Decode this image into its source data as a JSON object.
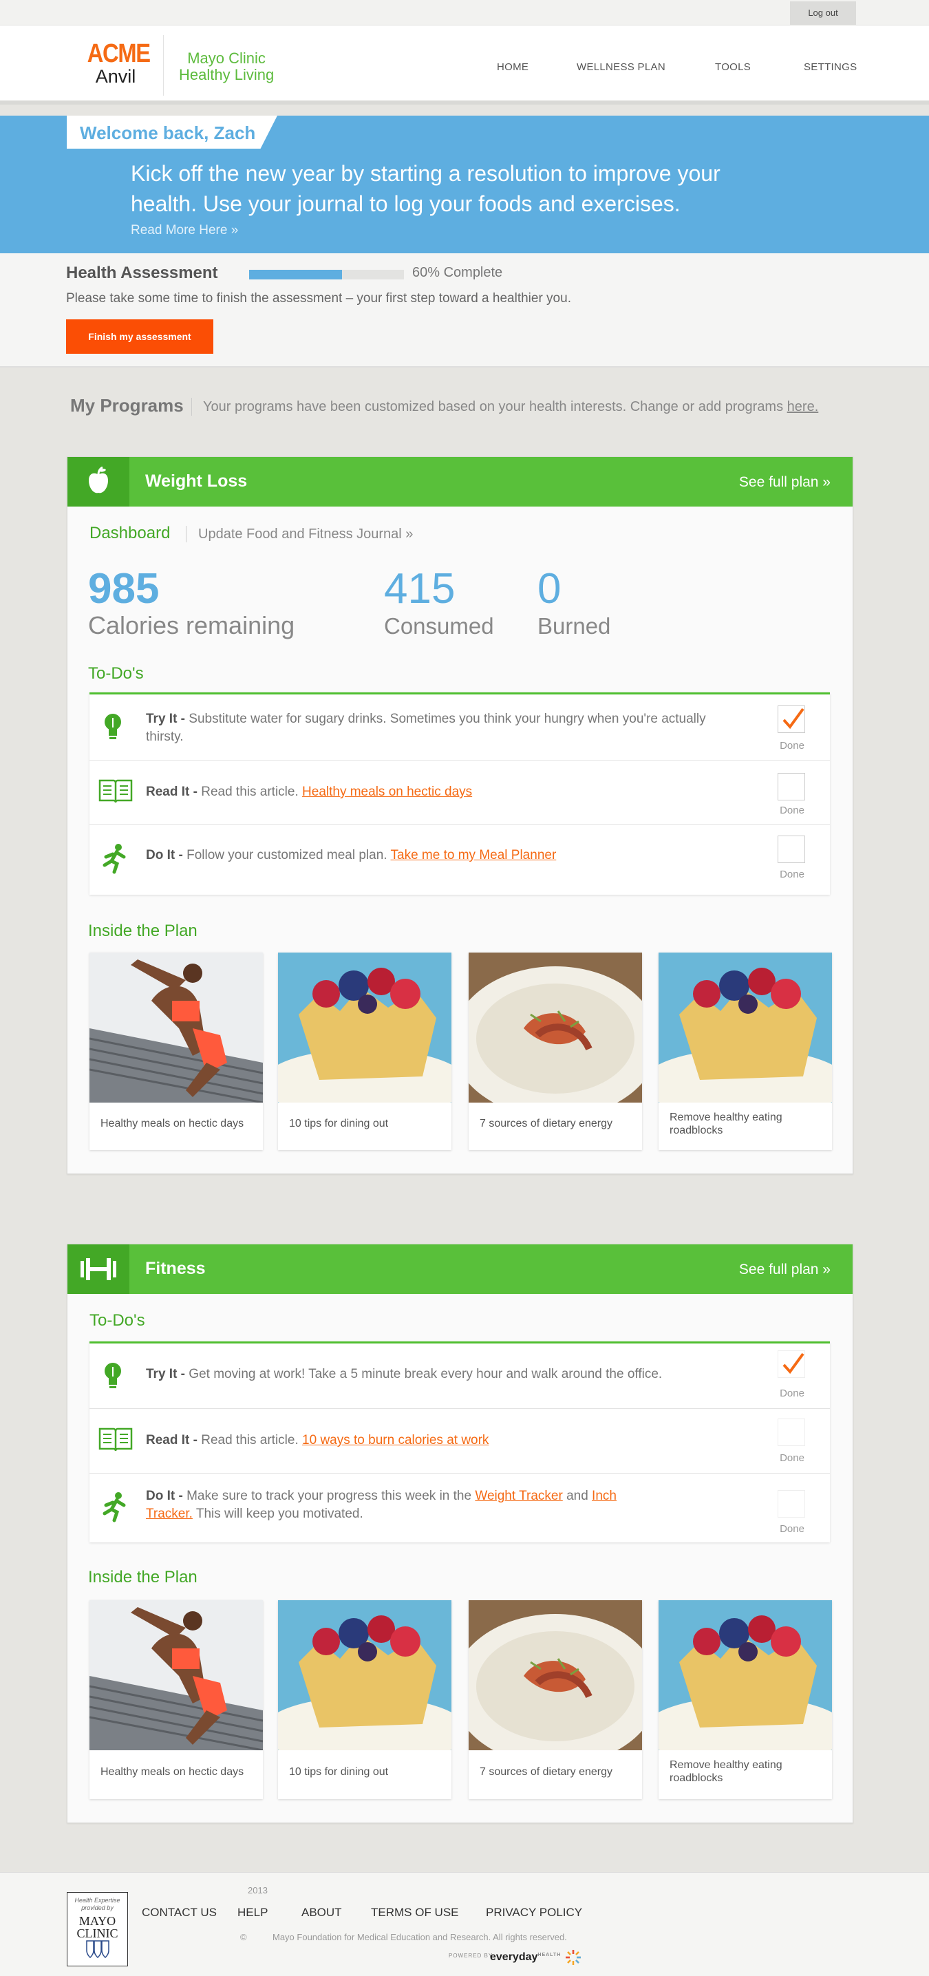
{
  "topbar": {
    "logout_label": "Log out"
  },
  "header": {
    "logo_line1": "ACME",
    "logo_line2": "Anvil",
    "partner_line1": "Mayo Clinic",
    "partner_line2": "Healthy Living",
    "nav": [
      "HOME",
      "WELLNESS PLAN",
      "TOOLS",
      "SETTINGS"
    ]
  },
  "banner": {
    "welcome": "Welcome back, Zach",
    "message": "Kick off the new year by starting a resolution to improve your health. Use your journal to log your foods and exercises.",
    "read_more": "Read More Here »"
  },
  "assessment": {
    "title": "Health Assessment",
    "progress_percent": 60,
    "progress_text": "60% Complete",
    "description": "Please take some time to finish the assessment – your first step toward a healthier you.",
    "button": "Finish my assessment"
  },
  "programs": {
    "title": "My Programs",
    "description": "Your programs have been customized based on your health interests. Change or add programs",
    "link": "here."
  },
  "weight_loss": {
    "title": "Weight Loss",
    "full_plan": "See full plan »",
    "dashboard_tab": "Dashboard",
    "update_tab": "Update Food and Fitness Journal »",
    "stats": {
      "remaining_value": "985",
      "remaining_label": "Calories remaining",
      "consumed_value": "415",
      "consumed_label": "Consumed",
      "burned_value": "0",
      "burned_label": "Burned"
    },
    "todo_heading": "To-Do's",
    "todos": [
      {
        "type": "Try It -",
        "text": "Substitute water for sugary drinks. Sometimes you think your hungry when you're actually thirsty.",
        "done": true,
        "done_label": "Done"
      },
      {
        "type": "Read It -",
        "text": "Read this article.",
        "link": "Healthy meals on hectic days",
        "done": false,
        "done_label": "Done"
      },
      {
        "type": "Do It -",
        "text": "Follow your customized meal plan.",
        "link": "Take me to my Meal Planner",
        "done": false,
        "done_label": "Done"
      }
    ],
    "inside_heading": "Inside the Plan",
    "articles": [
      "Healthy meals on hectic days",
      "10 tips for dining out",
      "7 sources of dietary energy",
      "Remove healthy eating roadblocks"
    ]
  },
  "fitness": {
    "title": "Fitness",
    "full_plan": "See full plan »",
    "todo_heading": "To-Do's",
    "todos": [
      {
        "type": "Try It -",
        "text": "Get moving at work! Take a 5 minute break every hour and walk around the office.",
        "done": true,
        "done_label": "Done"
      },
      {
        "type": "Read It -",
        "text": "Read this article.",
        "link": "10 ways to burn calories at work",
        "done": false,
        "done_label": "Done"
      },
      {
        "type": "Do It -",
        "text_before": "Make sure to track your progress this week in the",
        "link1": "Weight Tracker",
        "and": "and",
        "link2a": "Inch",
        "link2b": "Tracker.",
        "text_after": "This will keep you motivated.",
        "done": false,
        "done_label": "Done"
      }
    ],
    "inside_heading": "Inside the Plan",
    "articles": [
      "Healthy meals on hectic days",
      "10 tips for dining out",
      "7 sources of dietary energy",
      "Remove healthy eating roadblocks"
    ]
  },
  "footer": {
    "badge_line1": "Health Expertise",
    "badge_line2": "provided by",
    "badge_line3": "MAYO",
    "badge_line4": "CLINIC",
    "year": "2013",
    "links": [
      "CONTACT US",
      "HELP",
      "ABOUT",
      "TERMS OF USE",
      "PRIVACY POLICY"
    ],
    "copyright_symbol": "©",
    "copyright": "Mayo Foundation for Medical Education and Research. All rights reserved.",
    "powered": "POWERED BY",
    "everyday": "everyday",
    "health": "HEALTH"
  },
  "colors": {
    "accent_blue": "#5eaee0",
    "brand_green": "#59c03a",
    "cta_orange": "#fb4e05",
    "link_orange": "#f56a14"
  }
}
